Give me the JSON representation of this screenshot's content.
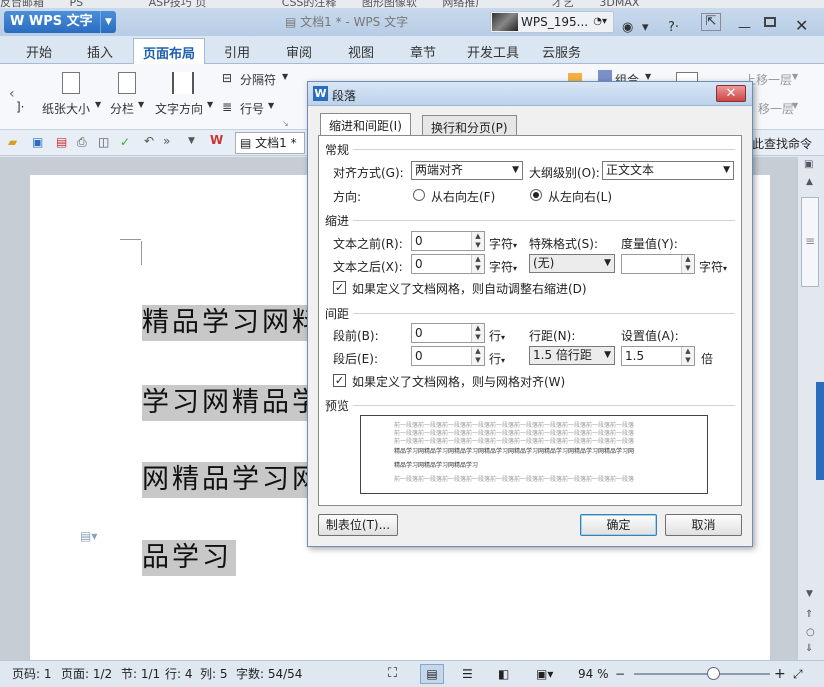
{
  "bookmarks": [
    "反台邮箱",
    "PS",
    "ASP技巧 页",
    "CSS的注释",
    "图形图像软",
    "网络推广",
    "才艺",
    "3DMAX"
  ],
  "titlebar": {
    "app_menu": "WPS 文字",
    "doc_title": "文档1 * - WPS 文字",
    "user": "WPS_195..."
  },
  "tabs": [
    "开始",
    "插入",
    "页面布局",
    "引用",
    "审阅",
    "视图",
    "章节",
    "开发工具",
    "云服务"
  ],
  "active_tab": "页面布局",
  "ribbon": {
    "left_cut": "]·",
    "paper_size": "纸张大小",
    "columns": "分栏",
    "text_direction": "文字方向",
    "separator": "分隔符",
    "line_number": "行号",
    "group": "组合",
    "bring_forward": "上移一层",
    "send_backward": "移一层"
  },
  "qat": {
    "doc_tab": "文档1 *",
    "find_cmd": "此查找命令"
  },
  "document": {
    "lines": [
      "精品学习网料",
      "学习网精品学",
      "网精品学习网",
      "品学习"
    ]
  },
  "status": {
    "page_code": "页码: 1",
    "page": "页面: 1/2",
    "section": "节: 1/1",
    "row": "行: 4",
    "col": "列: 5",
    "words": "字数: 54/54",
    "zoom": "94 %"
  },
  "zoom_fraction": 0.58,
  "dialog": {
    "title": "段落",
    "tab_indent": "缩进和间距(I)",
    "tab_page": "换行和分页(P)",
    "sec_general": "常规",
    "align_label": "对齐方式(G):",
    "align_value": "两端对齐",
    "outline_label": "大纲级别(O):",
    "outline_value": "正文文本",
    "direction_label": "方向:",
    "rtl_label": "从右向左(F)",
    "ltr_label": "从左向右(L)",
    "sec_indent": "缩进",
    "before_text_label": "文本之前(R):",
    "before_text_value": "0",
    "unit_char": "字符",
    "after_text_label": "文本之后(X):",
    "after_text_value": "0",
    "special_label": "特殊格式(S):",
    "special_value": "(无)",
    "measure_label": "度量值(Y):",
    "measure_value": "",
    "grid_indent_check": "如果定义了文档网格，则自动调整右缩进(D)",
    "sec_spacing": "间距",
    "before_para_label": "段前(B):",
    "before_para_value": "0",
    "unit_line": "行",
    "after_para_label": "段后(E):",
    "after_para_value": "0",
    "line_spacing_label": "行距(N):",
    "line_spacing_value": "1.5 倍行距",
    "set_value_label": "设置值(A):",
    "set_value": "1.5",
    "unit_times": "倍",
    "grid_align_check": "如果定义了文档网格，则与网格对齐(W)",
    "sec_preview": "预览",
    "preview_prev": "前一段落前一段落前一段落前一段落前一段落前一段落前一段落前一段落前一段落前一段落",
    "preview_cur1": "精品学习网精品学习网精品学习网精品学习网精品学习网精品学习网精品学习网精品学习网",
    "preview_cur2": "精品学习网精品学习网精品学习",
    "tabs_btn": "制表位(T)...",
    "ok": "确定",
    "cancel": "取消"
  },
  "colors": {
    "accent": "#2b6cbf",
    "selection": "#c8c8c8"
  }
}
